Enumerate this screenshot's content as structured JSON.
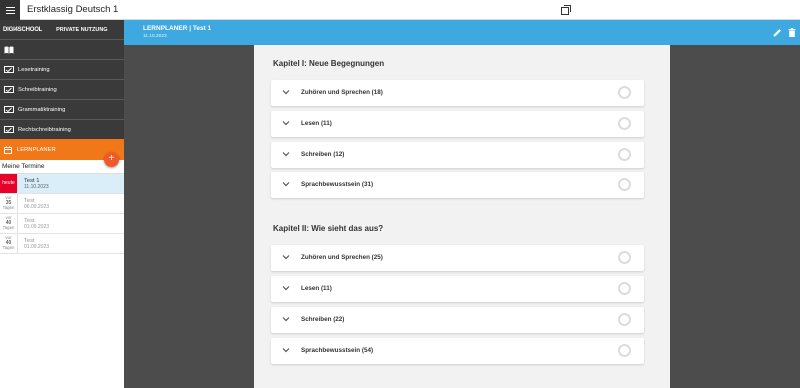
{
  "app": {
    "title": "Erstklassig Deutsch 1"
  },
  "sidebar": {
    "brand": "DIGI4SCHOOL",
    "brand_sub": "PRIVATE NUTZUNG",
    "items": [
      {
        "label": "Lesetraining"
      },
      {
        "label": "Schreibtraining"
      },
      {
        "label": "Grammatiktraining"
      },
      {
        "label": "Rechtschreibtraining"
      }
    ],
    "lernplaner_label": "LERNPLANER",
    "add_label": "+",
    "termine_title": "Meine Termine",
    "termine": [
      {
        "badge": "heute",
        "badge_num": "",
        "badge_unit": "",
        "title": "Test 1",
        "date": "11.10.2023",
        "state": "active"
      },
      {
        "badge": "vor",
        "badge_num": "35",
        "badge_unit": "Tagen",
        "title": "Test",
        "date": "06.09.2023",
        "state": "past"
      },
      {
        "badge": "vor",
        "badge_num": "40",
        "badge_unit": "Tagen",
        "title": "Test",
        "date": "01.09.2023",
        "state": "past"
      },
      {
        "badge": "vor",
        "badge_num": "40",
        "badge_unit": "Tagen",
        "title": "Test",
        "date": "01.09.2023",
        "state": "past"
      }
    ]
  },
  "header": {
    "title": "LERNPLANER | Test 1",
    "date": "11.10.2023"
  },
  "chapters": [
    {
      "title": "Kapitel I: Neue Begegnungen",
      "topics": [
        {
          "label": "Zuhören und Sprechen (18)"
        },
        {
          "label": "Lesen (11)"
        },
        {
          "label": "Schreiben (12)"
        },
        {
          "label": "Sprachbewusstsein (31)"
        }
      ]
    },
    {
      "title": "Kapitel II: Wie sieht das aus?",
      "topics": [
        {
          "label": "Zuhören und Sprechen (25)"
        },
        {
          "label": "Lesen (11)"
        },
        {
          "label": "Schreiben (22)"
        },
        {
          "label": "Sprachbewusstsein (54)"
        }
      ]
    }
  ],
  "colors": {
    "header_blue": "#3ea8e0",
    "lernplaner_orange": "#f07818",
    "today_red": "#e6002a"
  }
}
